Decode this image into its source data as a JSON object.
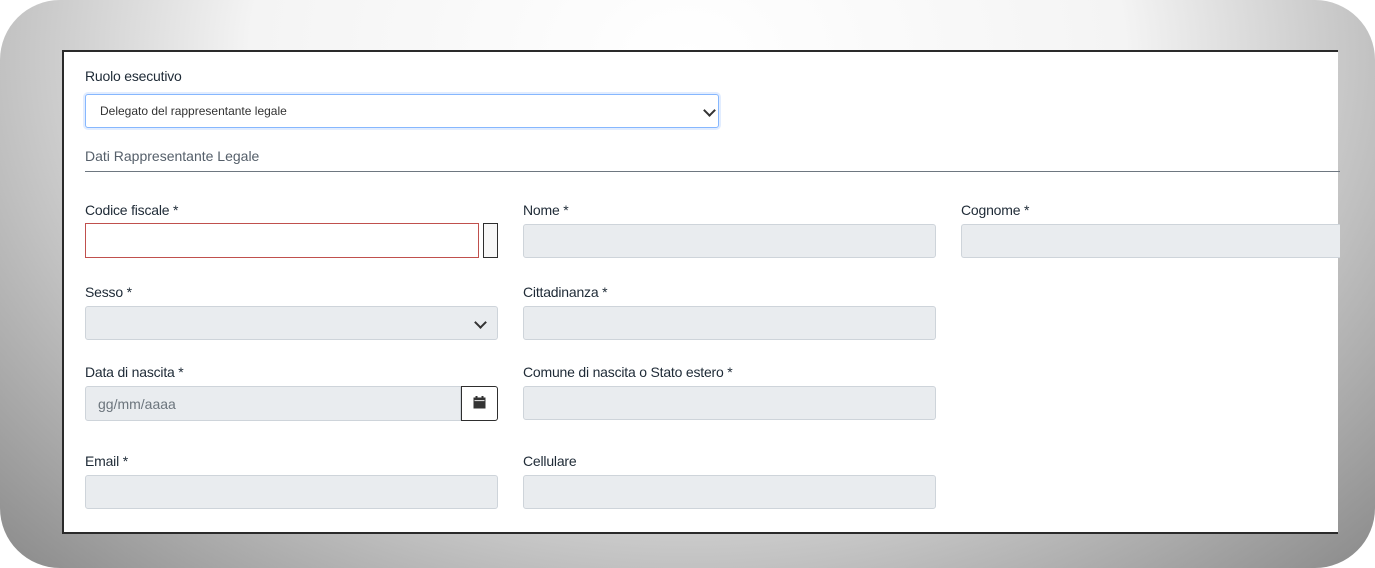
{
  "form": {
    "role": {
      "label": "Ruolo esecutivo",
      "selected": "Delegato del rappresentante legale"
    },
    "section_title": "Dati Rappresentante Legale",
    "fields": {
      "codice_fiscale": {
        "label": "Codice fiscale *",
        "value": ""
      },
      "nome": {
        "label": "Nome *",
        "value": ""
      },
      "cognome": {
        "label": "Cognome *",
        "value": ""
      },
      "sesso": {
        "label": "Sesso *",
        "selected": ""
      },
      "cittadinanza": {
        "label": "Cittadinanza *",
        "value": ""
      },
      "data_nascita": {
        "label": "Data di nascita *",
        "placeholder": "gg/mm/aaaa"
      },
      "comune_nascita": {
        "label": "Comune di nascita o Stato estero *",
        "value": ""
      },
      "email": {
        "label": "Email *",
        "value": ""
      },
      "cellulare": {
        "label": "Cellulare",
        "value": ""
      }
    }
  },
  "icons": {
    "dropdown": "chevron-down-icon",
    "calendar": "calendar-icon"
  },
  "colors": {
    "focus_border": "#86b7fe",
    "error_border": "#c0504d",
    "disabled_fill": "#e9ecef"
  }
}
